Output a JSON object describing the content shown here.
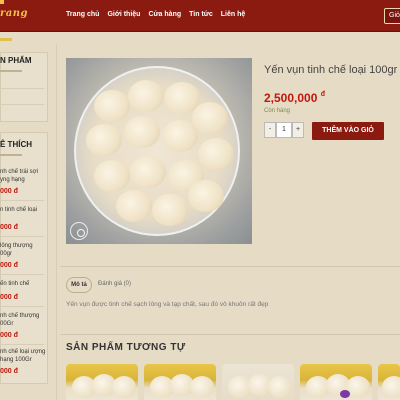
{
  "header": {
    "logo_text": "rang",
    "nav": [
      "Trang chủ",
      "Giới thiệu",
      "Cửa hàng",
      "Tin tức",
      "Liên hệ"
    ],
    "cart_label": "Giỏ"
  },
  "sidebar": {
    "box1_title": "N PHẨM",
    "box2_title": "Ê THÍCH",
    "products": [
      {
        "name": "nh chế trái sợi yng hạng",
        "price": "000 đ"
      },
      {
        "name": "n tinh chế loại",
        "price": "000 đ"
      },
      {
        "name": "lông thượng 00gr",
        "price": "000 đ"
      },
      {
        "name": "ến tinh chế",
        "price": "000 đ"
      },
      {
        "name": "nh chế thượng 00Gr",
        "price": "000 đ"
      },
      {
        "name": "nh chế loại ượng hạng 100Gr",
        "price": "000 đ"
      }
    ]
  },
  "product": {
    "title": "Yến vụn tinh chế loại 100gr",
    "price": "2,500,000",
    "currency": "đ",
    "stock": "Còn hàng",
    "qty_minus": "-",
    "qty_value": "1",
    "qty_plus": "+",
    "add_to_cart": "THÊM VÀO GIỎ"
  },
  "tabs": {
    "description": "Mô tả",
    "reviews": "Đánh giá (0)"
  },
  "description_text": "Yến vụn được tinh chế sạch lông và tạp chất, sau đó vô khuôn rất đẹp",
  "related": {
    "title": "SẢN PHẨM TƯƠNG TỰ"
  },
  "colors": {
    "header_bg": "#8b1a10",
    "price": "#c0180c",
    "page_bg": "#e6dcc6"
  }
}
